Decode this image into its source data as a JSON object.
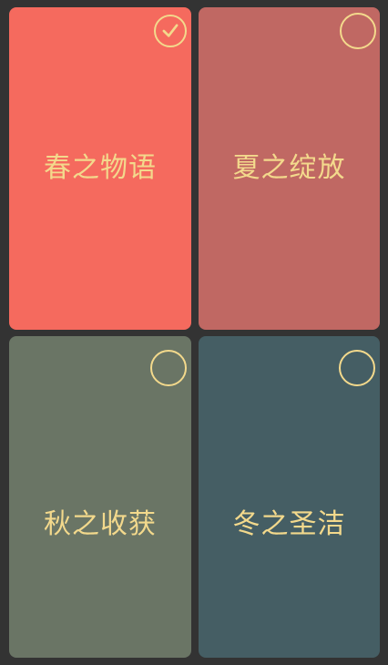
{
  "cards": [
    {
      "label": "春之物语",
      "bg": "#f56a5e",
      "text_color": "#f3d98c",
      "selected": true,
      "icon": "checkmark-circle-icon"
    },
    {
      "label": "夏之绽放",
      "bg": "#c06863",
      "text_color": "#f3d98c",
      "selected": false,
      "icon": "empty-circle-icon"
    },
    {
      "label": "秋之收获",
      "bg": "#6a7565",
      "text_color": "#f3d98c",
      "selected": false,
      "icon": "empty-circle-icon"
    },
    {
      "label": "冬之圣洁",
      "bg": "#455e64",
      "text_color": "#f3d98c",
      "selected": false,
      "icon": "empty-circle-icon"
    }
  ],
  "colors": {
    "background": "#333333",
    "accent": "#f3d98c"
  }
}
